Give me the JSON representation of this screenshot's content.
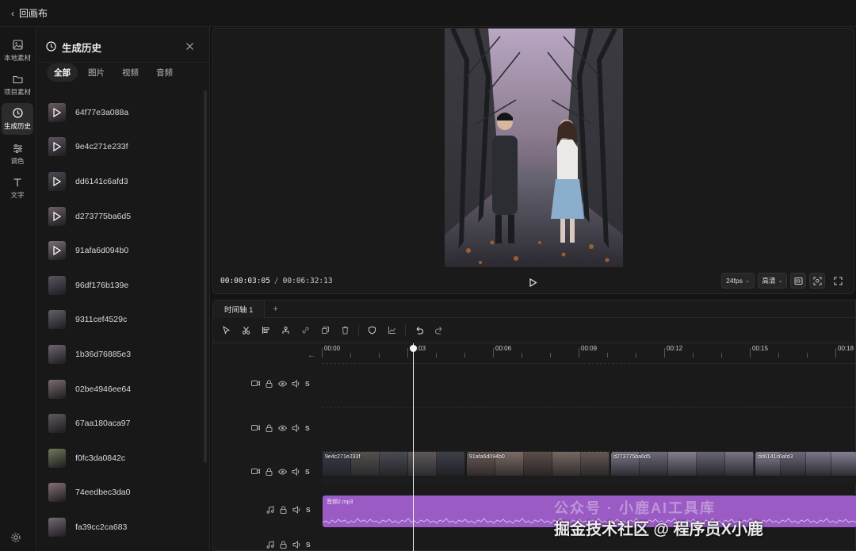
{
  "topbar": {
    "back_label": "回画布"
  },
  "rail": {
    "items": [
      {
        "label": "本地素材",
        "icon": "image-icon"
      },
      {
        "label": "项目素材",
        "icon": "folder-icon"
      },
      {
        "label": "生成历史",
        "icon": "clock-icon"
      },
      {
        "label": "调色",
        "icon": "sliders-icon"
      },
      {
        "label": "文字",
        "icon": "text-icon"
      }
    ],
    "settings_icon": "gear-icon"
  },
  "history": {
    "title": "生成历史",
    "tabs": [
      "全部",
      "图片",
      "视频",
      "音频"
    ],
    "items": [
      {
        "name": "64f77e3a088a",
        "type": "video"
      },
      {
        "name": "9e4c271e233f",
        "type": "video"
      },
      {
        "name": "dd6141c6afd3",
        "type": "video"
      },
      {
        "name": "d273775ba6d5",
        "type": "video"
      },
      {
        "name": "91afa6d094b0",
        "type": "video"
      },
      {
        "name": "96df176b139e",
        "type": "image"
      },
      {
        "name": "9311cef4529c",
        "type": "image"
      },
      {
        "name": "1b36d76885e3",
        "type": "image"
      },
      {
        "name": "02be4946ee64",
        "type": "image"
      },
      {
        "name": "67aa180aca97",
        "type": "image"
      },
      {
        "name": "f0fc3da0842c",
        "type": "image"
      },
      {
        "name": "74eedbec3da0",
        "type": "image"
      },
      {
        "name": "fa39cc2ca683",
        "type": "image"
      }
    ]
  },
  "preview": {
    "current_time": "00:00:03:05",
    "separator": "/",
    "total_time": "00:06:32:13",
    "fps_label": "24fps",
    "quality_label": "高清"
  },
  "timeline": {
    "tab_label": "时间轴 1",
    "add_label": "+",
    "ruler_labels": [
      "00:00",
      "00:03",
      "00:06",
      "00:09",
      "00:12",
      "00:15",
      "00:18"
    ],
    "solo_label": "S",
    "video_clips": [
      "9e4c271e233f",
      "91afa6d094b0",
      "d273775ba6d5",
      "dd6141c6afd3"
    ],
    "audio_clip": "音频2.mp3",
    "playhead_time_seconds": 3.2
  },
  "watermark": {
    "line1": "公众号 · 小鹿AI工具库",
    "line2": "掘金技术社区 @ 程序员X小鹿"
  },
  "colors": {
    "accent_audio": "#9a5cc4",
    "background": "#141414"
  }
}
